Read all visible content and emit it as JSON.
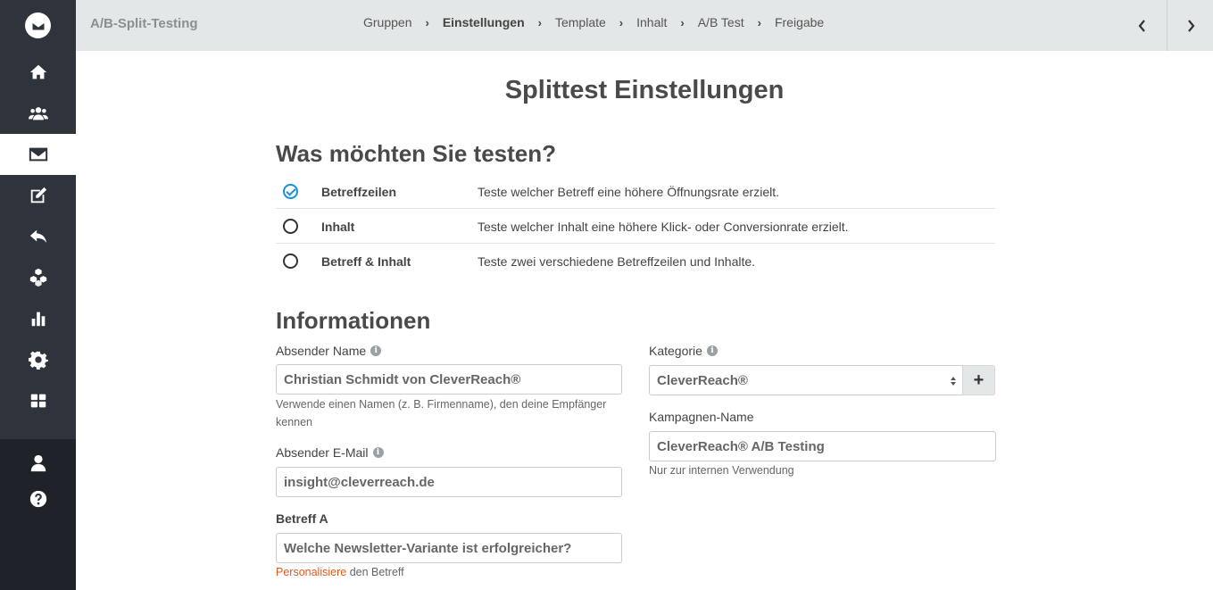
{
  "app": {
    "title": "A/B-Split-Testing"
  },
  "sidebar": {
    "items": [
      {
        "icon": "home-icon"
      },
      {
        "icon": "users-icon"
      },
      {
        "icon": "envelope-icon",
        "active": true
      },
      {
        "icon": "edit-icon"
      },
      {
        "icon": "reply-icon"
      },
      {
        "icon": "cubes-icon"
      },
      {
        "icon": "bar-chart-icon"
      },
      {
        "icon": "gear-icon"
      },
      {
        "icon": "grid-icon"
      },
      {
        "icon": "user-icon"
      },
      {
        "icon": "help-icon"
      }
    ]
  },
  "steps": [
    "Gruppen",
    "Einstellungen",
    "Template",
    "Inhalt",
    "A/B Test",
    "Freigabe"
  ],
  "active_step": "Einstellungen",
  "page": {
    "title": "Splittest Einstellungen",
    "test_heading": "Was möchten Sie testen?",
    "info_heading": "Informationen"
  },
  "options": [
    {
      "name": "Betreffzeilen",
      "desc": "Teste welcher Betreff eine höhere Öffnungsrate erzielt.",
      "selected": true
    },
    {
      "name": "Inhalt",
      "desc": "Teste welcher Inhalt eine höhere Klick- oder Conversionrate erzielt.",
      "selected": false
    },
    {
      "name": "Betreff & Inhalt",
      "desc": "Teste zwei verschiedene Betreffzeilen und Inhalte.",
      "selected": false
    }
  ],
  "form": {
    "sender_name": {
      "label": "Absender Name",
      "value": "Christian Schmidt von CleverReach®",
      "help": "Verwende einen Namen (z. B. Firmenname), den deine Empfänger kennen"
    },
    "sender_email": {
      "label": "Absender E-Mail",
      "value": "insight@cleverreach.de"
    },
    "subject_a": {
      "label": "Betreff A",
      "value": "Welche Newsletter-Variante ist erfolgreicher?",
      "help_link": "Personalisiere",
      "help_text": " den Betreff"
    },
    "category": {
      "label": "Kategorie",
      "value": "CleverReach®",
      "add": "+"
    },
    "campaign_name": {
      "label": "Kampagnen-Name",
      "value": "CleverReach® A/B Testing",
      "help": "Nur zur internen Verwendung"
    }
  },
  "colors": {
    "sidebar": "#2f333b",
    "topbar": "#e4e7e7",
    "accent": "#1a8fd8",
    "link": "#e05a1c"
  }
}
